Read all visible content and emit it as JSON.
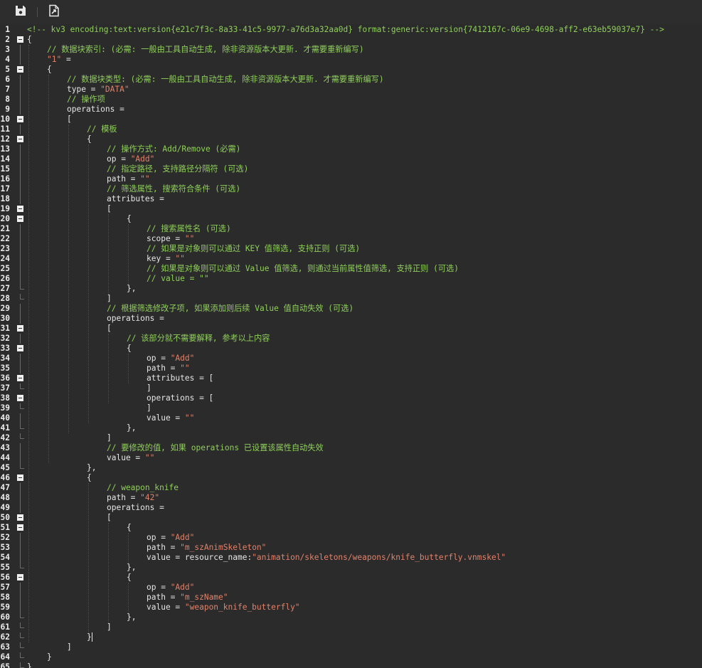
{
  "toolbar": {
    "save_icon": "floppy-disk-icon",
    "export_icon": "export-file-icon"
  },
  "colors": {
    "background": "#2b2b2b",
    "comment": "#8fd05a",
    "identifier": "#e6e6e6",
    "string": "#e0826b"
  },
  "lines": [
    {
      "n": "1",
      "fold": "",
      "indent": 0,
      "parts": [
        [
          "h",
          "<!-- kv3 encoding:text:version{e21c7f3c-8a33-41c5-9977-a76d3a32aa0d} format:generic:version{7412167c-06e9-4698-aff2-e63eb59037e7} -->"
        ]
      ]
    },
    {
      "n": "2",
      "fold": "open",
      "indent": 0,
      "parts": [
        [
          "i",
          "{"
        ]
      ]
    },
    {
      "n": "3",
      "fold": "line",
      "indent": 1,
      "parts": [
        [
          "c",
          "// 数据块索引: (必需: 一般由工具自动生成, 除非资源版本大更新. 才需要重新编写)"
        ]
      ]
    },
    {
      "n": "4",
      "fold": "line",
      "indent": 1,
      "parts": [
        [
          "s",
          "\"1\""
        ],
        [
          "i",
          " ="
        ]
      ]
    },
    {
      "n": "5",
      "fold": "open",
      "indent": 1,
      "parts": [
        [
          "i",
          "{"
        ]
      ]
    },
    {
      "n": "6",
      "fold": "line",
      "indent": 2,
      "parts": [
        [
          "c",
          "// 数据块类型: (必需: 一般由工具自动生成, 除非资源版本大更新. 才需要重新编写)"
        ]
      ]
    },
    {
      "n": "7",
      "fold": "line",
      "indent": 2,
      "parts": [
        [
          "i",
          "type = "
        ],
        [
          "s",
          "\"DATA\""
        ]
      ]
    },
    {
      "n": "8",
      "fold": "line",
      "indent": 2,
      "parts": [
        [
          "c",
          "// 操作项"
        ]
      ]
    },
    {
      "n": "9",
      "fold": "line",
      "indent": 2,
      "parts": [
        [
          "i",
          "operations ="
        ]
      ]
    },
    {
      "n": "10",
      "fold": "open",
      "indent": 2,
      "parts": [
        [
          "i",
          "["
        ]
      ]
    },
    {
      "n": "11",
      "fold": "line",
      "indent": 3,
      "parts": [
        [
          "c",
          "// 模板"
        ]
      ]
    },
    {
      "n": "12",
      "fold": "open",
      "indent": 3,
      "parts": [
        [
          "i",
          "{"
        ]
      ]
    },
    {
      "n": "13",
      "fold": "line",
      "indent": 4,
      "parts": [
        [
          "c",
          "// 操作方式: Add/Remove (必需)"
        ]
      ]
    },
    {
      "n": "14",
      "fold": "line",
      "indent": 4,
      "parts": [
        [
          "i",
          "op = "
        ],
        [
          "s",
          "\"Add\""
        ]
      ]
    },
    {
      "n": "15",
      "fold": "line",
      "indent": 4,
      "parts": [
        [
          "c",
          "// 指定路径, 支持路径分隔符 (可选)"
        ]
      ]
    },
    {
      "n": "16",
      "fold": "line",
      "indent": 4,
      "parts": [
        [
          "i",
          "path = "
        ],
        [
          "s",
          "\"\""
        ]
      ]
    },
    {
      "n": "17",
      "fold": "line",
      "indent": 4,
      "parts": [
        [
          "c",
          "// 筛选属性, 搜索符合条件 (可选)"
        ]
      ]
    },
    {
      "n": "18",
      "fold": "line",
      "indent": 4,
      "parts": [
        [
          "i",
          "attributes ="
        ]
      ]
    },
    {
      "n": "19",
      "fold": "open",
      "indent": 4,
      "parts": [
        [
          "i",
          "["
        ]
      ]
    },
    {
      "n": "20",
      "fold": "open",
      "indent": 5,
      "parts": [
        [
          "i",
          "{"
        ]
      ]
    },
    {
      "n": "21",
      "fold": "line",
      "indent": 6,
      "parts": [
        [
          "c",
          "// 搜索属性名 (可选)"
        ]
      ]
    },
    {
      "n": "22",
      "fold": "line",
      "indent": 6,
      "parts": [
        [
          "i",
          "scope = "
        ],
        [
          "s",
          "\"\""
        ]
      ]
    },
    {
      "n": "23",
      "fold": "line",
      "indent": 6,
      "parts": [
        [
          "c",
          "// 如果是对象则可以通过 KEY 值筛选, 支持正则 (可选)"
        ]
      ]
    },
    {
      "n": "24",
      "fold": "line",
      "indent": 6,
      "parts": [
        [
          "i",
          "key = "
        ],
        [
          "s",
          "\"\""
        ]
      ]
    },
    {
      "n": "25",
      "fold": "line",
      "indent": 6,
      "parts": [
        [
          "c",
          "// 如果是对象则可以通过 Value 值筛选, 则通过当前属性值筛选, 支持正则 (可选)"
        ]
      ]
    },
    {
      "n": "26",
      "fold": "line",
      "indent": 6,
      "parts": [
        [
          "c",
          "// value = \"\""
        ]
      ]
    },
    {
      "n": "27",
      "fold": "end",
      "indent": 5,
      "parts": [
        [
          "i",
          "},"
        ]
      ]
    },
    {
      "n": "28",
      "fold": "end",
      "indent": 4,
      "parts": [
        [
          "i",
          "]"
        ]
      ]
    },
    {
      "n": "29",
      "fold": "line",
      "indent": 4,
      "parts": [
        [
          "c",
          "// 根据筛选修改子项, 如果添加则后续 Value 值自动失效 (可选)"
        ]
      ]
    },
    {
      "n": "30",
      "fold": "line",
      "indent": 4,
      "parts": [
        [
          "i",
          "operations ="
        ]
      ]
    },
    {
      "n": "31",
      "fold": "open",
      "indent": 4,
      "parts": [
        [
          "i",
          "["
        ]
      ]
    },
    {
      "n": "32",
      "fold": "line",
      "indent": 5,
      "parts": [
        [
          "c",
          "// 该部分就不需要解释, 参考以上内容"
        ]
      ]
    },
    {
      "n": "33",
      "fold": "open",
      "indent": 5,
      "parts": [
        [
          "i",
          "{"
        ]
      ]
    },
    {
      "n": "34",
      "fold": "line",
      "indent": 6,
      "parts": [
        [
          "i",
          "op = "
        ],
        [
          "s",
          "\"Add\""
        ]
      ]
    },
    {
      "n": "35",
      "fold": "line",
      "indent": 6,
      "parts": [
        [
          "i",
          "path = "
        ],
        [
          "s",
          "\"\""
        ]
      ]
    },
    {
      "n": "36",
      "fold": "open",
      "indent": 6,
      "parts": [
        [
          "i",
          "attributes = ["
        ]
      ]
    },
    {
      "n": "37",
      "fold": "end",
      "indent": 6,
      "parts": [
        [
          "i",
          "]"
        ]
      ]
    },
    {
      "n": "38",
      "fold": "open",
      "indent": 6,
      "parts": [
        [
          "i",
          "operations = ["
        ]
      ]
    },
    {
      "n": "39",
      "fold": "end",
      "indent": 6,
      "parts": [
        [
          "i",
          "]"
        ]
      ]
    },
    {
      "n": "40",
      "fold": "line",
      "indent": 6,
      "parts": [
        [
          "i",
          "value = "
        ],
        [
          "s",
          "\"\""
        ]
      ]
    },
    {
      "n": "41",
      "fold": "end",
      "indent": 5,
      "parts": [
        [
          "i",
          "},"
        ]
      ]
    },
    {
      "n": "42",
      "fold": "end",
      "indent": 4,
      "parts": [
        [
          "i",
          "]"
        ]
      ]
    },
    {
      "n": "43",
      "fold": "line",
      "indent": 4,
      "parts": [
        [
          "c",
          "// 要修改的值, 如果 operations 已设置该属性自动失效"
        ]
      ]
    },
    {
      "n": "44",
      "fold": "line",
      "indent": 4,
      "parts": [
        [
          "i",
          "value = "
        ],
        [
          "s",
          "\"\""
        ]
      ]
    },
    {
      "n": "45",
      "fold": "end",
      "indent": 3,
      "parts": [
        [
          "i",
          "},"
        ]
      ]
    },
    {
      "n": "46",
      "fold": "open",
      "indent": 3,
      "parts": [
        [
          "i",
          "{"
        ]
      ]
    },
    {
      "n": "47",
      "fold": "line",
      "indent": 4,
      "parts": [
        [
          "c",
          "// weapon_knife"
        ]
      ]
    },
    {
      "n": "48",
      "fold": "line",
      "indent": 4,
      "parts": [
        [
          "i",
          "path = "
        ],
        [
          "s",
          "\"42\""
        ]
      ]
    },
    {
      "n": "49",
      "fold": "line",
      "indent": 4,
      "parts": [
        [
          "i",
          "operations ="
        ]
      ]
    },
    {
      "n": "50",
      "fold": "open",
      "indent": 4,
      "parts": [
        [
          "i",
          "["
        ]
      ]
    },
    {
      "n": "51",
      "fold": "open",
      "indent": 5,
      "parts": [
        [
          "i",
          "{"
        ]
      ]
    },
    {
      "n": "52",
      "fold": "line",
      "indent": 6,
      "parts": [
        [
          "i",
          "op = "
        ],
        [
          "s",
          "\"Add\""
        ]
      ]
    },
    {
      "n": "53",
      "fold": "line",
      "indent": 6,
      "parts": [
        [
          "i",
          "path = "
        ],
        [
          "s",
          "\"m_szAnimSkeleton\""
        ]
      ]
    },
    {
      "n": "54",
      "fold": "line",
      "indent": 6,
      "parts": [
        [
          "i",
          "value = resource_name:"
        ],
        [
          "s",
          "\"animation/skeletons/weapons/knife_butterfly.vnmskel\""
        ]
      ]
    },
    {
      "n": "55",
      "fold": "end",
      "indent": 5,
      "parts": [
        [
          "i",
          "},"
        ]
      ]
    },
    {
      "n": "56",
      "fold": "open",
      "indent": 5,
      "parts": [
        [
          "i",
          "{"
        ]
      ]
    },
    {
      "n": "57",
      "fold": "line",
      "indent": 6,
      "parts": [
        [
          "i",
          "op = "
        ],
        [
          "s",
          "\"Add\""
        ]
      ]
    },
    {
      "n": "58",
      "fold": "line",
      "indent": 6,
      "parts": [
        [
          "i",
          "path = "
        ],
        [
          "s",
          "\"m_szName\""
        ]
      ]
    },
    {
      "n": "59",
      "fold": "line",
      "indent": 6,
      "parts": [
        [
          "i",
          "value = "
        ],
        [
          "s",
          "\"weapon_knife_butterfly\""
        ]
      ]
    },
    {
      "n": "60",
      "fold": "end",
      "indent": 5,
      "parts": [
        [
          "i",
          "},"
        ]
      ]
    },
    {
      "n": "61",
      "fold": "end",
      "indent": 4,
      "parts": [
        [
          "i",
          "]"
        ]
      ]
    },
    {
      "n": "62",
      "fold": "end",
      "indent": 3,
      "parts": [
        [
          "i",
          "}"
        ]
      ]
    },
    {
      "n": "63",
      "fold": "end",
      "indent": 2,
      "parts": [
        [
          "i",
          "]"
        ]
      ]
    },
    {
      "n": "64",
      "fold": "end",
      "indent": 1,
      "parts": [
        [
          "i",
          "}"
        ]
      ]
    },
    {
      "n": "65",
      "fold": "end",
      "indent": 0,
      "parts": [
        [
          "i",
          "}"
        ]
      ]
    }
  ]
}
